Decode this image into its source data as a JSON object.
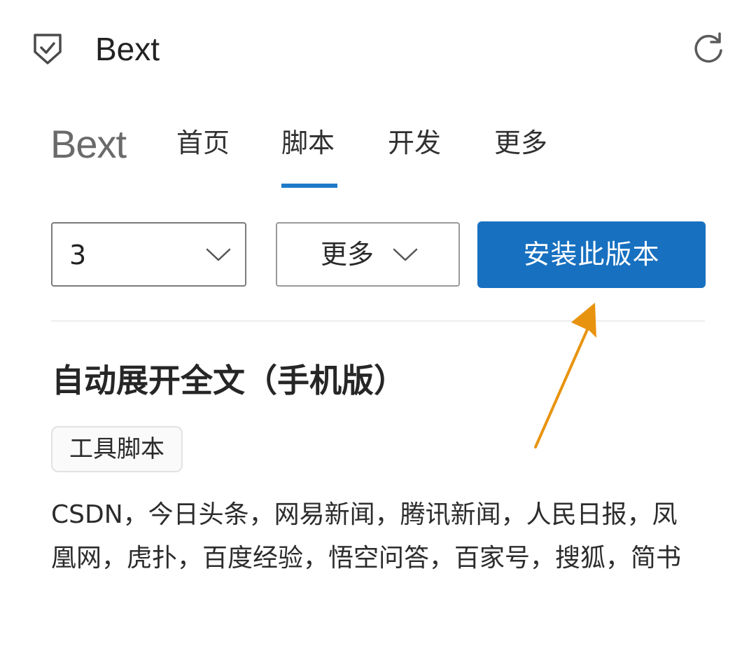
{
  "app": {
    "title": "Bext",
    "icon": "shield-check-icon",
    "refresh_icon": "refresh-icon"
  },
  "nav": {
    "brand": "Bext",
    "tabs": [
      {
        "label": "首页",
        "active": false
      },
      {
        "label": "脚本",
        "active": true
      },
      {
        "label": "开发",
        "active": false
      },
      {
        "label": "更多",
        "active": false
      }
    ],
    "accent_color": "#1e7ac8"
  },
  "controls": {
    "version_value": "3",
    "more_label": "更多",
    "install_label": "安装此版本",
    "install_color": "#1770c0"
  },
  "script": {
    "title": "自动展开全文（手机版）",
    "tag": "工具脚本",
    "description": "CSDN，今日头条，网易新闻，腾讯新闻，人民日报，凤凰网，虎扑，百度经验，悟空问答，百家号，搜狐，简书"
  },
  "annotation": {
    "arrow_color": "#e8930f"
  }
}
